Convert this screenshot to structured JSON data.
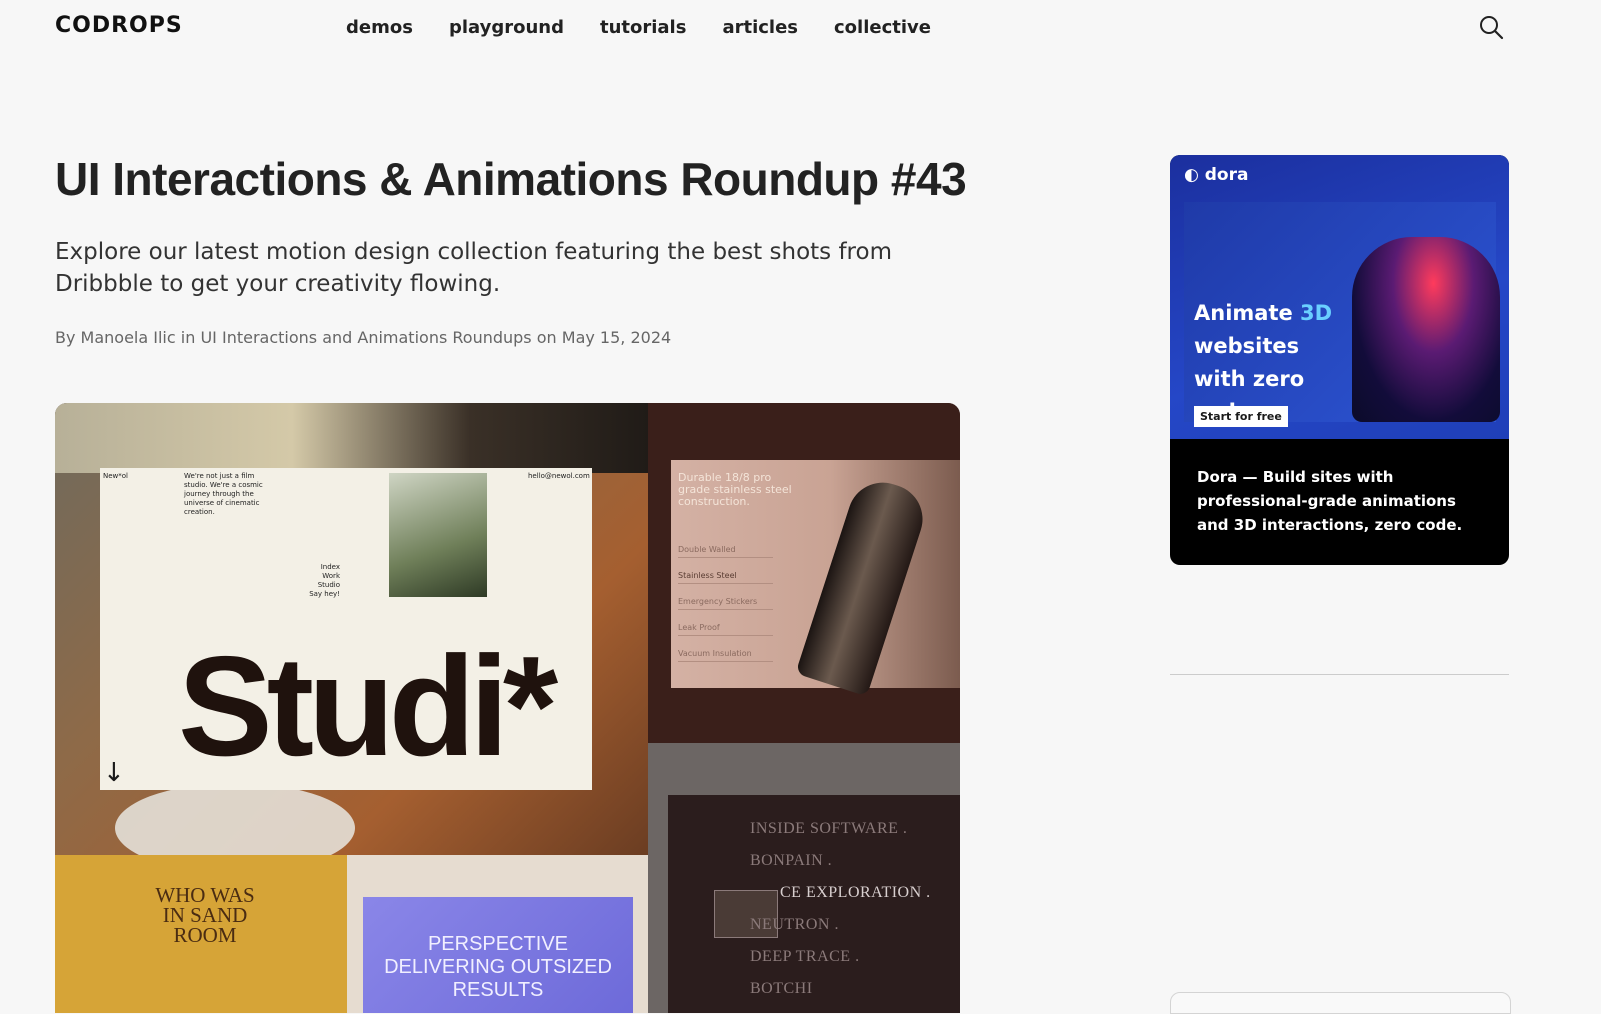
{
  "header": {
    "logo": "CODROPS",
    "nav": [
      "demos",
      "playground",
      "tutorials",
      "articles",
      "collective"
    ]
  },
  "article": {
    "title": "UI Interactions & Animations Roundup #43",
    "subtitle": "Explore our latest motion design collection featuring the best shots from Dribbble to get your creativity flowing.",
    "meta": {
      "by": "By",
      "author": "Manoela Ilic",
      "in": "in",
      "category": "UI Interactions and Animations Roundups",
      "on": "on",
      "date": "May 15, 2024"
    }
  },
  "hero": {
    "studio_word": "Studi*",
    "studio_tag": "New*ol",
    "studio_intro": "We're not just a film studio. We're a cosmic journey through the universe of cinematic creation.",
    "studio_email": "hello@newol.com",
    "studio_menu": [
      "Index",
      "Work",
      "Studio",
      "Say hey!"
    ],
    "bottle_headline": "Durable 18/8 pro grade stainless steel construction.",
    "bottle_features": [
      "Double Walled",
      "Stainless Steel",
      "Emergency Stickers",
      "Leak Proof",
      "Vacuum Insulation"
    ],
    "list_items": [
      "INSIDE SOFTWARE .",
      "BONPAIN .",
      "CE EXPLORATION .",
      "NEUTRON .",
      "DEEP TRACE .",
      "BOTCHI"
    ],
    "who_text": "WHO WAS IN SAND ROOM",
    "perspective_text": "PERSPECTIVE DELIVERING OUTSIZED RESULTS"
  },
  "ad": {
    "brand": "dora",
    "headline_pre": "Animate ",
    "headline_accent": "3D",
    "headline_post": " websites with zero code.",
    "cta": "Start for free",
    "body": "Dora — Build sites with professional-grade animations and 3D interactions, zero code.",
    "accent_color": "#6ad0ff"
  },
  "icons": {
    "search": "search-icon"
  }
}
